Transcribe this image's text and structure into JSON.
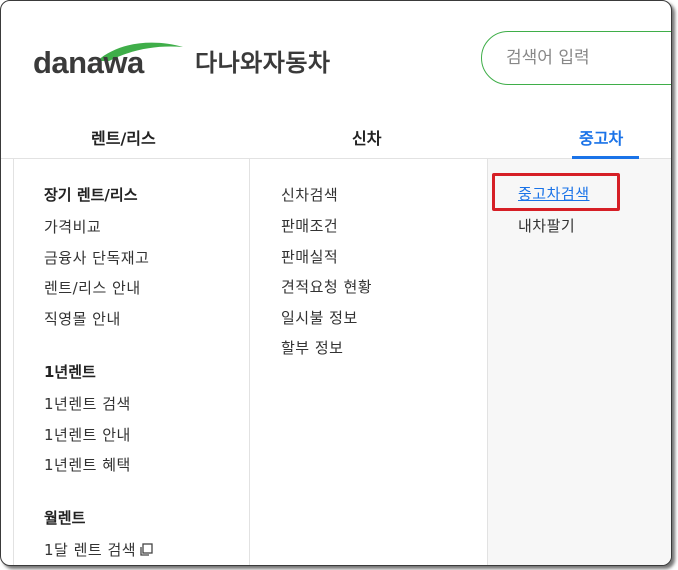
{
  "brand": {
    "logo_text": "danawa",
    "title": "다나와자동차"
  },
  "search": {
    "placeholder": "검색어 입력"
  },
  "tabs": [
    {
      "label": "렌트/리스"
    },
    {
      "label": "신차"
    },
    {
      "label": "중고차",
      "active": true
    }
  ],
  "menu": {
    "rent": {
      "sections": [
        {
          "heading": "장기 렌트/리스",
          "items": [
            "가격비교",
            "금융사 단독재고",
            "렌트/리스 안내",
            "직영몰 안내"
          ]
        },
        {
          "heading": "1년렌트",
          "items": [
            "1년렌트 검색",
            "1년렌트 안내",
            "1년렌트 혜택"
          ]
        },
        {
          "heading": "월렌트",
          "items": [
            "1달 렌트 검색"
          ]
        }
      ]
    },
    "newcar": {
      "items": [
        "신차검색",
        "판매조건",
        "판매실적",
        "견적요청 현황",
        "일시불 정보",
        "할부 정보"
      ]
    },
    "used": {
      "items": [
        "중고차검색",
        "내차팔기"
      ]
    }
  },
  "colors": {
    "accent_blue": "#1a73e8",
    "brand_green": "#3fae49",
    "highlight_red": "#d61f26"
  }
}
